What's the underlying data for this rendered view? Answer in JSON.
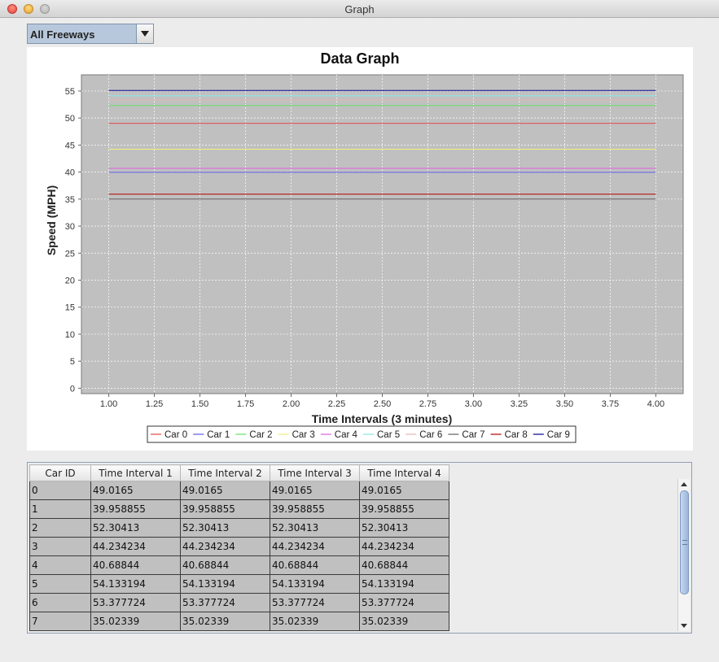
{
  "window": {
    "title": "Graph"
  },
  "filter": {
    "selected": "All Freeways"
  },
  "chart_data": {
    "type": "line",
    "title": "Data Graph",
    "xlabel": "Time Intervals (3 minutes)",
    "ylabel": "Speed (MPH)",
    "x": [
      1,
      2,
      3,
      4
    ],
    "xlim": [
      0.85,
      4.15
    ],
    "ylim": [
      -1,
      58
    ],
    "xticks": [
      "1.00",
      "1.25",
      "1.50",
      "1.75",
      "2.00",
      "2.25",
      "2.50",
      "2.75",
      "3.00",
      "3.25",
      "3.50",
      "3.75",
      "4.00"
    ],
    "yticks": [
      "0",
      "5",
      "10",
      "15",
      "20",
      "25",
      "30",
      "35",
      "40",
      "45",
      "50",
      "55"
    ],
    "grid": true,
    "legend_position": "bottom",
    "series": [
      {
        "name": "Car 0",
        "color": "#e64747",
        "values": [
          49.0165,
          49.0165,
          49.0165,
          49.0165
        ]
      },
      {
        "name": "Car 1",
        "color": "#5a5ae6",
        "values": [
          39.958855,
          39.958855,
          39.958855,
          39.958855
        ]
      },
      {
        "name": "Car 2",
        "color": "#66e066",
        "values": [
          52.30413,
          52.30413,
          52.30413,
          52.30413
        ]
      },
      {
        "name": "Car 3",
        "color": "#f0f07a",
        "values": [
          44.234234,
          44.234234,
          44.234234,
          44.234234
        ]
      },
      {
        "name": "Car 4",
        "color": "#e060e0",
        "values": [
          40.68844,
          40.68844,
          40.68844,
          40.68844
        ]
      },
      {
        "name": "Car 5",
        "color": "#8ae6e6",
        "values": [
          54.133194,
          54.133194,
          54.133194,
          54.133194
        ]
      },
      {
        "name": "Car 6",
        "color": "#e6b4b4",
        "values": [
          53.377724,
          53.377724,
          53.377724,
          53.377724
        ]
      },
      {
        "name": "Car 7",
        "color": "#606060",
        "values": [
          35.02339,
          35.02339,
          35.02339,
          35.02339
        ]
      },
      {
        "name": "Car 8",
        "color": "#b00000",
        "values": [
          35.9,
          35.9,
          35.9,
          35.9
        ]
      },
      {
        "name": "Car 9",
        "color": "#000090",
        "values": [
          55.1,
          55.1,
          55.1,
          55.1
        ]
      }
    ]
  },
  "table": {
    "headers": [
      "Car ID",
      "Time Interval 1",
      "Time Interval 2",
      "Time Interval 3",
      "Time Interval 4"
    ],
    "rows": [
      [
        "0",
        "49.0165",
        "49.0165",
        "49.0165",
        "49.0165"
      ],
      [
        "1",
        "39.958855",
        "39.958855",
        "39.958855",
        "39.958855"
      ],
      [
        "2",
        "52.30413",
        "52.30413",
        "52.30413",
        "52.30413"
      ],
      [
        "3",
        "44.234234",
        "44.234234",
        "44.234234",
        "44.234234"
      ],
      [
        "4",
        "40.68844",
        "40.68844",
        "40.68844",
        "40.68844"
      ],
      [
        "5",
        "54.133194",
        "54.133194",
        "54.133194",
        "54.133194"
      ],
      [
        "6",
        "53.377724",
        "53.377724",
        "53.377724",
        "53.377724"
      ],
      [
        "7",
        "35.02339",
        "35.02339",
        "35.02339",
        "35.02339"
      ],
      [
        "",
        "",
        "",
        "",
        ""
      ]
    ]
  }
}
